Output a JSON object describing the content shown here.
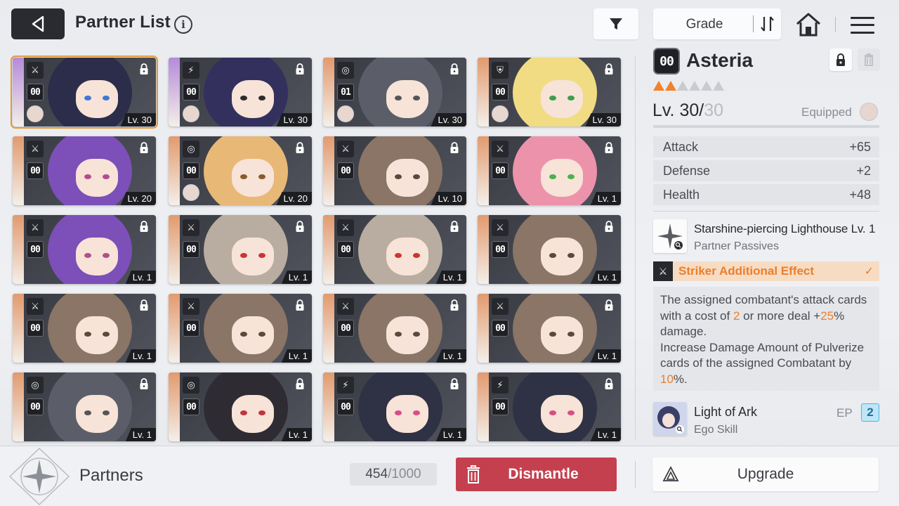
{
  "header": {
    "title": "Partner List",
    "info_glyph": "i",
    "sort_label": "Grade"
  },
  "cards": [
    {
      "class_icon": "⚔",
      "grade": "00",
      "level": "Lv. 30",
      "selected": true,
      "has_avatar": true,
      "hair": "#2b2d4a",
      "eye": "#3d78d6",
      "stripe": "#b58ad9"
    },
    {
      "class_icon": "⚡",
      "grade": "00",
      "level": "Lv. 30",
      "selected": false,
      "has_avatar": true,
      "hair": "#33305e",
      "eye": "#2b2b2b",
      "stripe": "#b58ad9"
    },
    {
      "class_icon": "◎",
      "grade": "01",
      "level": "Lv. 30",
      "selected": false,
      "has_avatar": true,
      "hair": "#5b5e69",
      "eye": "#555",
      "stripe": "#e29a6e"
    },
    {
      "class_icon": "⛨",
      "grade": "00",
      "level": "Lv. 30",
      "selected": false,
      "has_avatar": true,
      "hair": "#f1dc84",
      "eye": "#3b9f4a",
      "stripe": "#e29a6e"
    },
    {
      "class_icon": "⚔",
      "grade": "00",
      "level": "Lv. 20",
      "selected": false,
      "has_avatar": false,
      "hair": "#7d4fb8",
      "eye": "#b54c8d",
      "stripe": "#e29a6e"
    },
    {
      "class_icon": "◎",
      "grade": "00",
      "level": "Lv. 20",
      "selected": false,
      "has_avatar": true,
      "hair": "#e8b876",
      "eye": "#8a5a2b",
      "stripe": "#e29a6e"
    },
    {
      "class_icon": "⚔",
      "grade": "00",
      "level": "Lv. 10",
      "selected": false,
      "has_avatar": false,
      "hair": "#8a7566",
      "eye": "#5a4a3a",
      "stripe": "#e29a6e"
    },
    {
      "class_icon": "⚔",
      "grade": "00",
      "level": "Lv. 1",
      "selected": false,
      "has_avatar": false,
      "hair": "#ec93ab",
      "eye": "#4caf50",
      "stripe": "#e29a6e"
    },
    {
      "class_icon": "⚔",
      "grade": "00",
      "level": "Lv. 1",
      "selected": false,
      "has_avatar": false,
      "hair": "#7d4fb8",
      "eye": "#b54c8d",
      "stripe": "#e29a6e"
    },
    {
      "class_icon": "⚔",
      "grade": "00",
      "level": "Lv. 1",
      "selected": false,
      "has_avatar": false,
      "hair": "#b8ada0",
      "eye": "#c33",
      "stripe": "#e29a6e"
    },
    {
      "class_icon": "⚔",
      "grade": "00",
      "level": "Lv. 1",
      "selected": false,
      "has_avatar": false,
      "hair": "#b8ada0",
      "eye": "#c33",
      "stripe": "#e29a6e"
    },
    {
      "class_icon": "⚔",
      "grade": "00",
      "level": "Lv. 1",
      "selected": false,
      "has_avatar": false,
      "hair": "#8a7566",
      "eye": "#5a4a3a",
      "stripe": "#e29a6e"
    },
    {
      "class_icon": "⚔",
      "grade": "00",
      "level": "Lv. 1",
      "selected": false,
      "has_avatar": false,
      "hair": "#8a7566",
      "eye": "#5a4a3a",
      "stripe": "#e29a6e"
    },
    {
      "class_icon": "⚔",
      "grade": "00",
      "level": "Lv. 1",
      "selected": false,
      "has_avatar": false,
      "hair": "#8a7566",
      "eye": "#5a4a3a",
      "stripe": "#e29a6e"
    },
    {
      "class_icon": "⚔",
      "grade": "00",
      "level": "Lv. 1",
      "selected": false,
      "has_avatar": false,
      "hair": "#8a7566",
      "eye": "#5a4a3a",
      "stripe": "#e29a6e"
    },
    {
      "class_icon": "⚔",
      "grade": "00",
      "level": "Lv. 1",
      "selected": false,
      "has_avatar": false,
      "hair": "#8a7566",
      "eye": "#5a4a3a",
      "stripe": "#e29a6e"
    },
    {
      "class_icon": "◎",
      "grade": "00",
      "level": "Lv. 1",
      "selected": false,
      "has_avatar": false,
      "hair": "#5b5e69",
      "eye": "#555",
      "stripe": "#e29a6e"
    },
    {
      "class_icon": "◎",
      "grade": "00",
      "level": "Lv. 1",
      "selected": false,
      "has_avatar": false,
      "hair": "#2e2b33",
      "eye": "#c2333d",
      "stripe": "#e29a6e"
    },
    {
      "class_icon": "⚡",
      "grade": "00",
      "level": "Lv. 1",
      "selected": false,
      "has_avatar": false,
      "hair": "#2f3144",
      "eye": "#d94d86",
      "stripe": "#e29a6e"
    },
    {
      "class_icon": "⚡",
      "grade": "00",
      "level": "Lv. 1",
      "selected": false,
      "has_avatar": false,
      "hair": "#2f3144",
      "eye": "#d94d86",
      "stripe": "#e29a6e"
    }
  ],
  "detail": {
    "grade": "00",
    "name": "Asteria",
    "stars_filled": 2,
    "stars_total": 6,
    "level_current": "Lv. 30",
    "level_sep": "/",
    "level_max": "30",
    "equipped_label": "Equipped",
    "stats": [
      {
        "label": "Attack",
        "value": "+65"
      },
      {
        "label": "Defense",
        "value": "+2"
      },
      {
        "label": "Health",
        "value": "+48"
      }
    ],
    "passive": {
      "name": "Starshine-piercing Lighthouse Lv. 1",
      "sub": "Partner Passives"
    },
    "effect": {
      "title": "Striker Additional Effect",
      "text_parts": [
        {
          "t": "The assigned combatant's attack cards with a cost of ",
          "hl": false
        },
        {
          "t": "2",
          "hl": true
        },
        {
          "t": " or more deal +",
          "hl": false
        },
        {
          "t": "25",
          "hl": true
        },
        {
          "t": "% damage.",
          "hl": false
        },
        {
          "t": "\nIncrease Damage Amount of Pulverize cards of the assigned Combatant by ",
          "hl": false
        },
        {
          "t": "10",
          "hl": true
        },
        {
          "t": "%.",
          "hl": false
        }
      ]
    },
    "ego": {
      "name": "Light of Ark",
      "sub": "Ego Skill",
      "ep_label": "EP",
      "ep_value": "2"
    }
  },
  "bottom": {
    "partners_label": "Partners",
    "count_current": "454",
    "count_sep": " / ",
    "count_total": "1000",
    "dismantle_label": "Dismantle",
    "upgrade_label": "Upgrade"
  },
  "colors": {
    "accent_orange": "#ec7e2a",
    "dismantle_red": "#c4404f",
    "ep_blue": "#4fb3de"
  },
  "icons": {
    "back": "back-arrow-icon",
    "info": "info-icon",
    "filter": "filter-icon",
    "sort": "sort-direction-icon",
    "home": "home-icon",
    "menu": "menu-icon",
    "lock": "lock-icon",
    "trash": "trash-icon",
    "check": "check-icon",
    "magnifier": "magnifier-icon",
    "upgrade": "upgrade-icon"
  }
}
